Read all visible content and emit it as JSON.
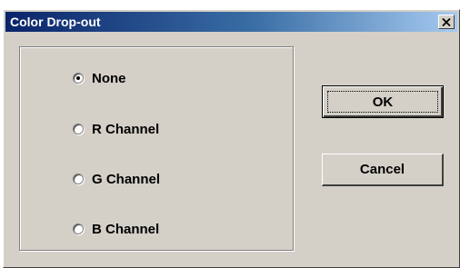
{
  "window": {
    "title": "Color Drop-out",
    "close_icon": "close-icon"
  },
  "options": {
    "selected": "None",
    "items": [
      {
        "label": "None",
        "checked": true
      },
      {
        "label": "R Channel",
        "checked": false
      },
      {
        "label": "G Channel",
        "checked": false
      },
      {
        "label": "B Channel",
        "checked": false
      }
    ]
  },
  "buttons": {
    "ok_label": "OK",
    "cancel_label": "Cancel"
  },
  "colors": {
    "title_gradient_start": "#0a246a",
    "title_gradient_end": "#a6caf0",
    "face": "#d4d0c8"
  }
}
